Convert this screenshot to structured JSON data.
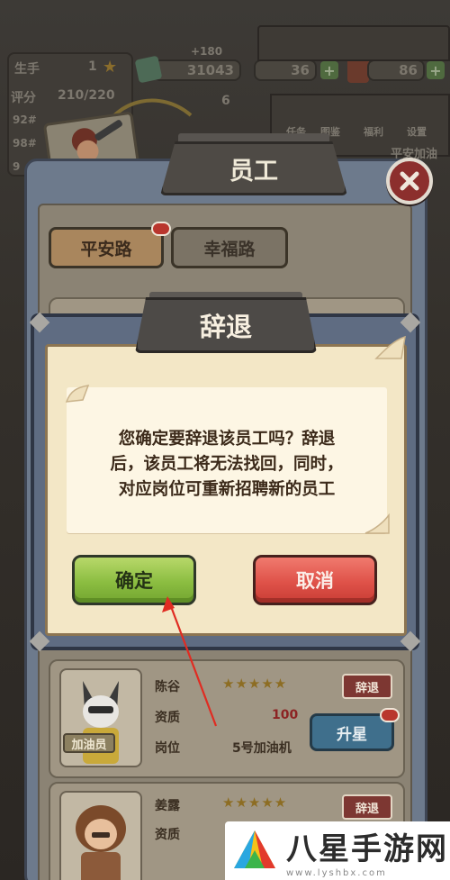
{
  "hud": {
    "player_rank_label": "生手",
    "player_level": "1",
    "rating_label": "评分",
    "rating_value": "210/220",
    "cash_hint": "+180",
    "cash": "31043",
    "sub_value": "6",
    "energy": "36",
    "gems": "86",
    "side_rows": [
      "92#",
      "98#",
      "9"
    ],
    "menu_labels": [
      "任务",
      "图鉴",
      "福利",
      "设置"
    ],
    "location_hint": "平安加油"
  },
  "panel": {
    "title": "员工",
    "tabs": [
      {
        "label": "平安路",
        "active": true,
        "has_notification": true
      },
      {
        "label": "幸福路",
        "active": false,
        "has_notification": false
      }
    ],
    "employees": [
      {
        "name": "陈谷",
        "role": "加油员",
        "stars": "★★★★★",
        "quality_label": "资质",
        "quality_value": "100",
        "position_label": "岗位",
        "position_value": "5号加油机",
        "fire_label": "辞退",
        "upgrade_label": "升星"
      },
      {
        "name": "姜露",
        "role": "",
        "stars": "★★★★★",
        "quality_label": "资质",
        "fire_label": "辞退"
      }
    ]
  },
  "dialog": {
    "title": "辞退",
    "message_lines": [
      "您确定要辞退该员工吗？辞退",
      "后，该员工将无法找回，同时，",
      "对应岗位可重新招聘新的员工"
    ],
    "confirm_label": "确定",
    "cancel_label": "取消"
  },
  "watermark": {
    "text": "八星手游网",
    "url": "www.lyshbx.com"
  },
  "colors": {
    "confirm": "#8bbd41",
    "cancel": "#df5249",
    "dialog_paper": "#f3e7c6",
    "annotation_arrow": "#e02c22"
  }
}
